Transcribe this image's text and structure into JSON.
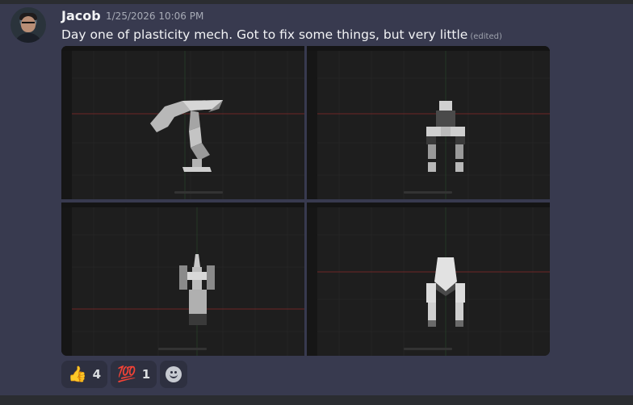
{
  "message": {
    "author": "Jacob",
    "timestamp": "1/25/2026 10:06 PM",
    "text": "Day one of plasticity mech. Got to fix some things, but very little",
    "edited_label": "(edited)"
  },
  "attachments": [
    {
      "view": "side"
    },
    {
      "view": "front"
    },
    {
      "view": "top"
    },
    {
      "view": "back"
    }
  ],
  "reactions": [
    {
      "emoji": "👍",
      "count": "4"
    },
    {
      "emoji": "💯",
      "count": "1"
    }
  ],
  "add_reaction_icon": "add-reaction-icon",
  "colors": {
    "background": "#383a4f",
    "viewport": "#1e1e1e",
    "x_axis": "#7a2a2a"
  }
}
